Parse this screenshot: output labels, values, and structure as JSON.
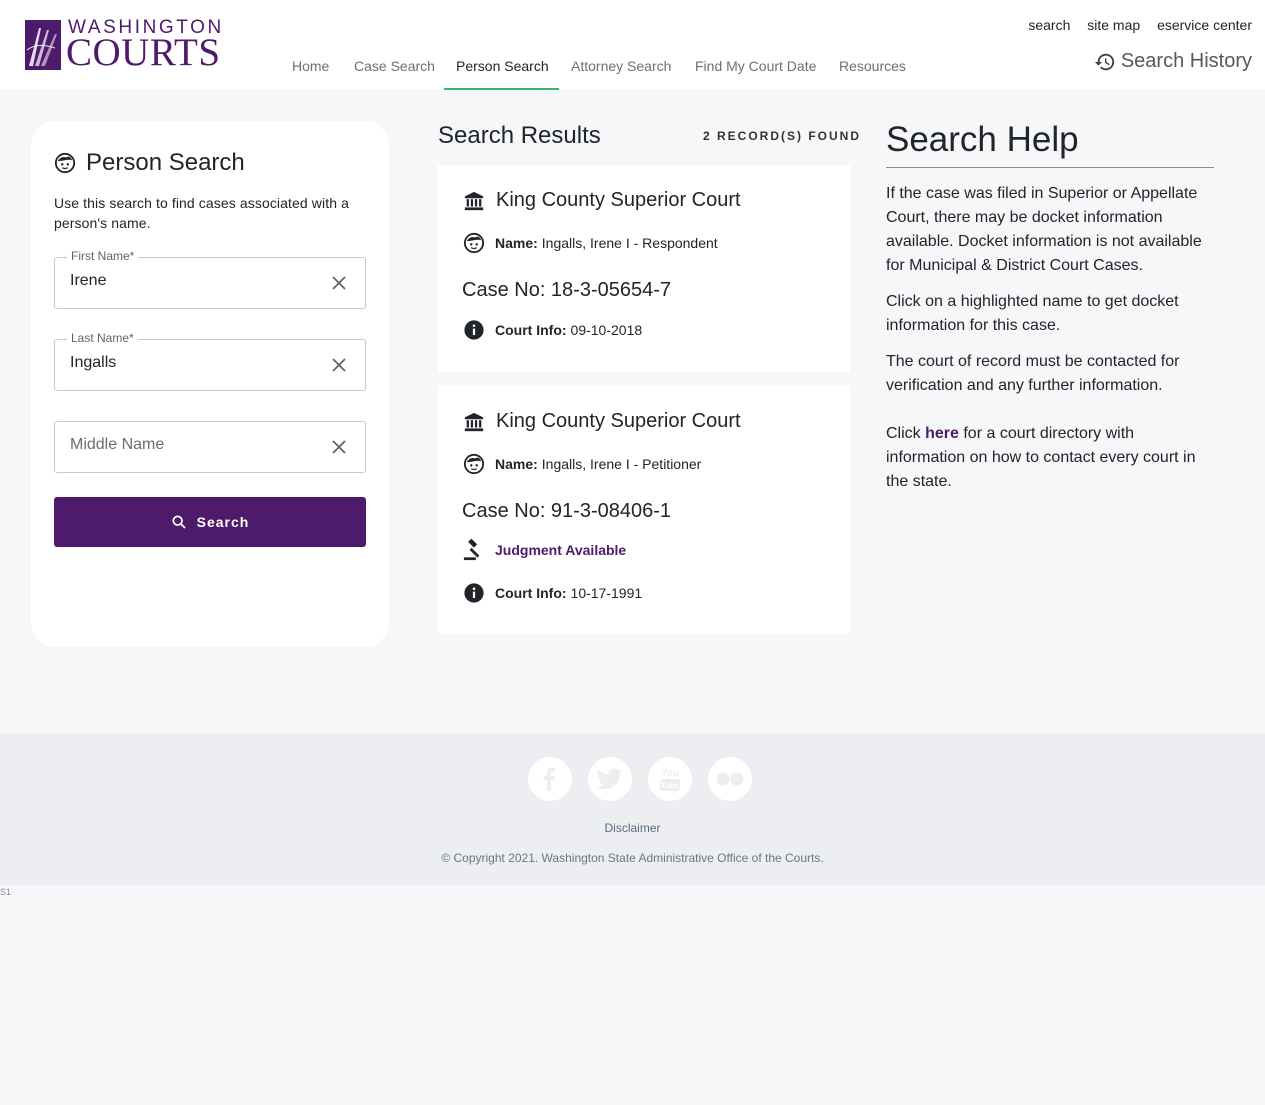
{
  "brand": {
    "top": "WASHINGTON",
    "bottom": "COURTS",
    "color": "#4e1a6b"
  },
  "utility": {
    "search": "search",
    "site_map": "site map",
    "eservice": "eservice center"
  },
  "nav": {
    "items": [
      "Home",
      "Case Search",
      "Person Search",
      "Attorney Search",
      "Find My Court Date",
      "Resources"
    ],
    "active": "Person Search",
    "accent": "#3cb371"
  },
  "history": {
    "label": "Search History",
    "icon": "history-icon"
  },
  "person_search": {
    "title": "Person Search",
    "icon": "person-face-icon",
    "description": "Use this search to find cases associated with a person's name.",
    "first_name": {
      "label": "First Name*",
      "value": "Irene"
    },
    "last_name": {
      "label": "Last Name*",
      "value": "Ingalls"
    },
    "middle_name": {
      "placeholder": "Middle Name",
      "value": ""
    },
    "button": "Search",
    "button_color": "#4e1a6b"
  },
  "results": {
    "title": "Search Results",
    "count": "2 RECORD(S) FOUND",
    "items": [
      {
        "court": "King County Superior Court",
        "name_label": "Name:",
        "name": "Ingalls, Irene I - Respondent",
        "case": "Case No: 18-3-05654-7",
        "court_info_label": "Court Info:",
        "court_info": "09-10-2018"
      },
      {
        "court": "King County Superior Court",
        "name_label": "Name:",
        "name": "Ingalls, Irene I - Petitioner",
        "case": "Case No: 91-3-08406-1",
        "judgment": "Judgment Available",
        "court_info_label": "Court Info:",
        "court_info": "10-17-1991"
      }
    ]
  },
  "help": {
    "title": "Search Help",
    "p1": "If the case was filed in Superior or Appellate Court, there may be docket information available. Docket information is not available for Municipal & District Court Cases.",
    "p2": "Click on a highlighted name to get docket information for this case.",
    "p3": "The court of record must be contacted for verification and any further information.",
    "p4_pre": "Click ",
    "p4_link": "here",
    "p4_post": " for a court directory with information on how to contact every court in the state."
  },
  "footer": {
    "social": [
      "facebook-icon",
      "twitter-icon",
      "youtube-icon",
      "flickr-icon"
    ],
    "disclaimer": "Disclaimer",
    "copyright": "© Copyright 2021. Washington State Administrative Office of the Courts."
  },
  "build": "S1"
}
